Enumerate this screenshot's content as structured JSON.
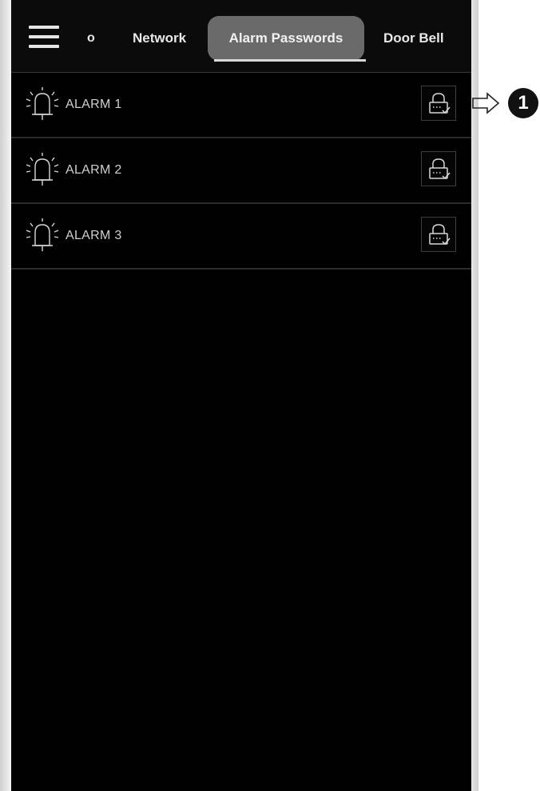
{
  "header": {
    "menu_icon": "hamburger-menu-icon",
    "tabs": [
      {
        "label": "o"
      },
      {
        "label": "Network"
      },
      {
        "label": "Alarm Passwords",
        "active": true
      },
      {
        "label": "Door Bell"
      }
    ]
  },
  "alarms": [
    {
      "label": "ALARM 1",
      "icon": "alarm-bell-icon",
      "action_icon": "lock-check-icon"
    },
    {
      "label": "ALARM 2",
      "icon": "alarm-bell-icon",
      "action_icon": "lock-check-icon"
    },
    {
      "label": "ALARM 3",
      "icon": "alarm-bell-icon",
      "action_icon": "lock-check-icon"
    }
  ],
  "callout": {
    "number": "1",
    "icon": "outline-arrow-right-icon"
  },
  "colors": {
    "background": "#000000",
    "active_tab": "#6a6a6a",
    "text": "#e8e8e8"
  }
}
